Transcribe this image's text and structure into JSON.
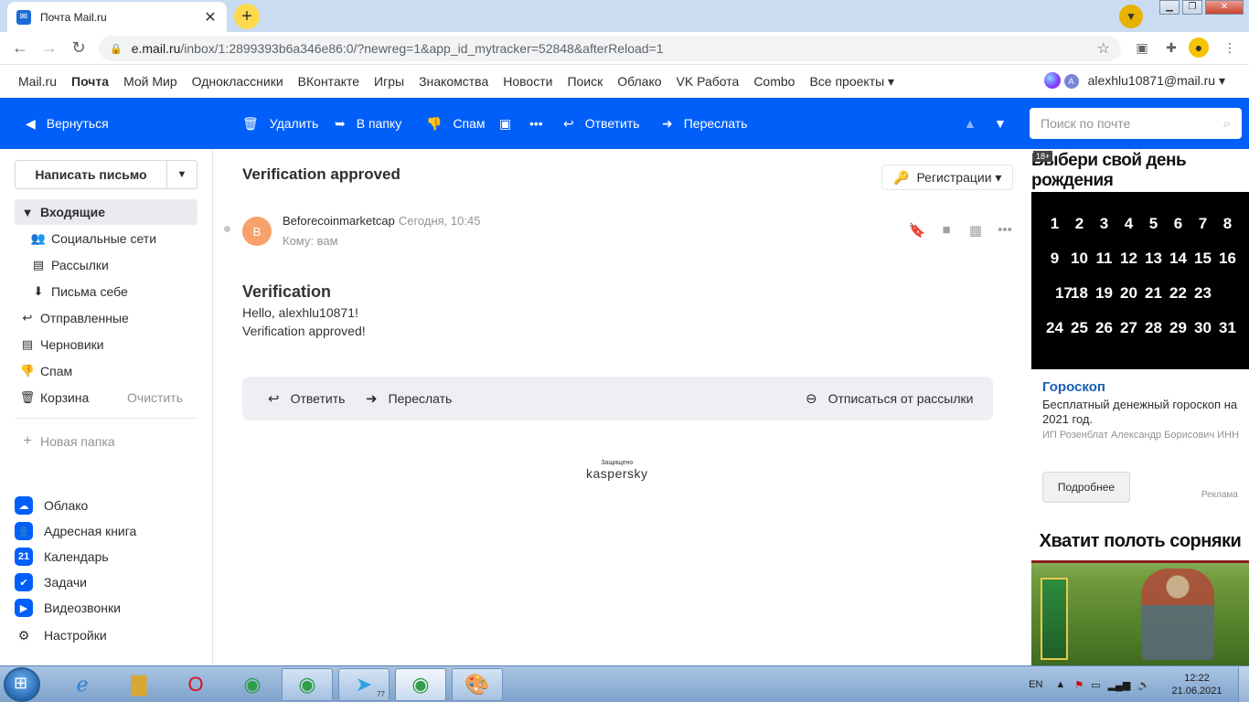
{
  "browser": {
    "tab_title": "Почта Mail.ru",
    "url_domain": "e.mail.ru",
    "url_path": "/inbox/1:2899393b6a346e86:0/?newreg=1&app_id_mytracker=52848&afterReload=1"
  },
  "portal": {
    "links": [
      "Mail.ru",
      "Почта",
      "Мой Мир",
      "Одноклассники",
      "ВКонтакте",
      "Игры",
      "Знакомства",
      "Новости",
      "Поиск",
      "Облако",
      "VK Работа",
      "Combo",
      "Все проекты ▾"
    ],
    "user_initial": "A",
    "user_email": "alexhlu10871@mail.ru ▾"
  },
  "toolbar": {
    "back": "Вернуться",
    "delete": "Удалить",
    "to_folder": "В папку",
    "spam": "Спам",
    "reply": "Ответить",
    "forward": "Переслать",
    "search_placeholder": "Поиск по почте"
  },
  "sidebar": {
    "compose": "Написать письмо",
    "folders": [
      {
        "label": "Входящие",
        "icon": "triangle-down-icon"
      },
      {
        "label": "Социальные сети",
        "icon": "people-icon"
      },
      {
        "label": "Рассылки",
        "icon": "newsletter-icon"
      },
      {
        "label": "Письма себе",
        "icon": "self-mail-icon"
      },
      {
        "label": "Отправленные",
        "icon": "sent-icon"
      },
      {
        "label": "Черновики",
        "icon": "draft-icon"
      },
      {
        "label": "Спам",
        "icon": "thumb-down-icon"
      },
      {
        "label": "Корзина",
        "icon": "trash-icon"
      }
    ],
    "clear": "Очистить",
    "new_folder": "Новая папка",
    "apps": [
      "Облако",
      "Адресная книга",
      "Календарь",
      "Задачи",
      "Видеозвонки",
      "Настройки"
    ],
    "calendar_day": "21"
  },
  "letter": {
    "subject": "Verification approved",
    "tag": "Регистрации ▾",
    "sender_initial": "B",
    "sender": "Beforecoinmarketcap",
    "date": "Сегодня, 10:45",
    "to": "Кому: вам",
    "heading": "Verification",
    "line1": "Hello, alexhlu10871!",
    "line2": "Verification approved!",
    "reply": "Ответить",
    "forward": "Переслать",
    "unsubscribe": "Отписаться от рассылки",
    "protected_small": "Защищено",
    "protected_brand": "kaspersky"
  },
  "ads": {
    "age": "18+",
    "banner1_title": "Выбери свой день рождения",
    "days": [
      "1",
      "2",
      "3",
      "4",
      "5",
      "6",
      "7",
      "8",
      "9",
      "10",
      "11",
      "12",
      "13",
      "14",
      "15",
      "16",
      "17",
      "18",
      "19",
      "20",
      "21",
      "22",
      "23",
      "24",
      "25",
      "26",
      "27",
      "28",
      "29",
      "30",
      "31"
    ],
    "title": "Гороскоп",
    "text": "Бесплатный денежный гороскоп на 2021 год.",
    "advertiser": "ИП Розенблат Александр Борисович ИНН",
    "button": "Подробнее",
    "label": "Реклама",
    "banner2_title": "Хватит полоть сорняки"
  },
  "taskbar": {
    "lang": "EN",
    "time": "12:22",
    "date": "21.06.2021",
    "telegram_badge": "77"
  },
  "colors": {
    "accent": "#005ff9",
    "sender_avatar": "#f6a26a"
  }
}
